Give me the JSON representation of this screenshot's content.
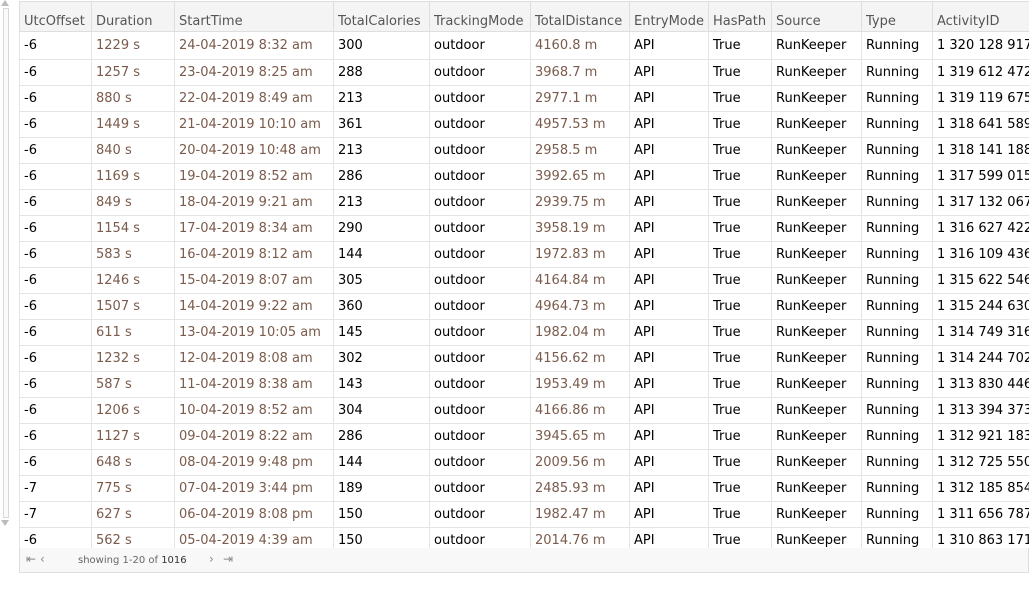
{
  "columns": [
    "UtcOffset",
    "Duration",
    "StartTime",
    "TotalCalories",
    "TrackingMode",
    "TotalDistance",
    "EntryMode",
    "HasPath",
    "Source",
    "Type",
    "ActivityID"
  ],
  "rows": [
    [
      "-6",
      "1229 s",
      "24-04-2019 8:32 am",
      "300",
      "outdoor",
      "4160.8 m",
      "API",
      "True",
      "RunKeeper",
      "Running",
      "1 320 128 917"
    ],
    [
      "-6",
      "1257 s",
      "23-04-2019 8:25 am",
      "288",
      "outdoor",
      "3968.7 m",
      "API",
      "True",
      "RunKeeper",
      "Running",
      "1 319 612 472"
    ],
    [
      "-6",
      "880 s",
      "22-04-2019 8:49 am",
      "213",
      "outdoor",
      "2977.1 m",
      "API",
      "True",
      "RunKeeper",
      "Running",
      "1 319 119 675"
    ],
    [
      "-6",
      "1449 s",
      "21-04-2019 10:10 am",
      "361",
      "outdoor",
      "4957.53 m",
      "API",
      "True",
      "RunKeeper",
      "Running",
      "1 318 641 589"
    ],
    [
      "-6",
      "840 s",
      "20-04-2019 10:48 am",
      "213",
      "outdoor",
      "2958.5 m",
      "API",
      "True",
      "RunKeeper",
      "Running",
      "1 318 141 188"
    ],
    [
      "-6",
      "1169 s",
      "19-04-2019 8:52 am",
      "286",
      "outdoor",
      "3992.65 m",
      "API",
      "True",
      "RunKeeper",
      "Running",
      "1 317 599 015"
    ],
    [
      "-6",
      "849 s",
      "18-04-2019 9:21 am",
      "213",
      "outdoor",
      "2939.75 m",
      "API",
      "True",
      "RunKeeper",
      "Running",
      "1 317 132 067"
    ],
    [
      "-6",
      "1154 s",
      "17-04-2019 8:34 am",
      "290",
      "outdoor",
      "3958.19 m",
      "API",
      "True",
      "RunKeeper",
      "Running",
      "1 316 627 422"
    ],
    [
      "-6",
      "583 s",
      "16-04-2019 8:12 am",
      "144",
      "outdoor",
      "1972.83 m",
      "API",
      "True",
      "RunKeeper",
      "Running",
      "1 316 109 436"
    ],
    [
      "-6",
      "1246 s",
      "15-04-2019 8:07 am",
      "305",
      "outdoor",
      "4164.84 m",
      "API",
      "True",
      "RunKeeper",
      "Running",
      "1 315 622 546"
    ],
    [
      "-6",
      "1507 s",
      "14-04-2019 9:22 am",
      "360",
      "outdoor",
      "4964.73 m",
      "API",
      "True",
      "RunKeeper",
      "Running",
      "1 315 244 630"
    ],
    [
      "-6",
      "611 s",
      "13-04-2019 10:05 am",
      "145",
      "outdoor",
      "1982.04 m",
      "API",
      "True",
      "RunKeeper",
      "Running",
      "1 314 749 316"
    ],
    [
      "-6",
      "1232 s",
      "12-04-2019 8:08 am",
      "302",
      "outdoor",
      "4156.62 m",
      "API",
      "True",
      "RunKeeper",
      "Running",
      "1 314 244 702"
    ],
    [
      "-6",
      "587 s",
      "11-04-2019 8:38 am",
      "143",
      "outdoor",
      "1953.49 m",
      "API",
      "True",
      "RunKeeper",
      "Running",
      "1 313 830 446"
    ],
    [
      "-6",
      "1206 s",
      "10-04-2019 8:52 am",
      "304",
      "outdoor",
      "4166.86 m",
      "API",
      "True",
      "RunKeeper",
      "Running",
      "1 313 394 373"
    ],
    [
      "-6",
      "1127 s",
      "09-04-2019 8:22 am",
      "286",
      "outdoor",
      "3945.65 m",
      "API",
      "True",
      "RunKeeper",
      "Running",
      "1 312 921 183"
    ],
    [
      "-6",
      "648 s",
      "08-04-2019 9:48 pm",
      "144",
      "outdoor",
      "2009.56 m",
      "API",
      "True",
      "RunKeeper",
      "Running",
      "1 312 725 550"
    ],
    [
      "-7",
      "775 s",
      "07-04-2019 3:44 pm",
      "189",
      "outdoor",
      "2485.93 m",
      "API",
      "True",
      "RunKeeper",
      "Running",
      "1 312 185 854"
    ],
    [
      "-7",
      "627 s",
      "06-04-2019 8:08 pm",
      "150",
      "outdoor",
      "1982.47 m",
      "API",
      "True",
      "RunKeeper",
      "Running",
      "1 311 656 787"
    ],
    [
      "-6",
      "562 s",
      "05-04-2019 4:39 am",
      "150",
      "outdoor",
      "2014.76 m",
      "API",
      "True",
      "RunKeeper",
      "Running",
      "1 310 863 171"
    ]
  ],
  "footer": {
    "first_icon": "first-page-icon",
    "prev_icon": "previous-page-icon",
    "next_icon": "next-page-icon",
    "last_icon": "last-page-icon",
    "showing_text": "showing 1-20 of",
    "total": "1016"
  }
}
